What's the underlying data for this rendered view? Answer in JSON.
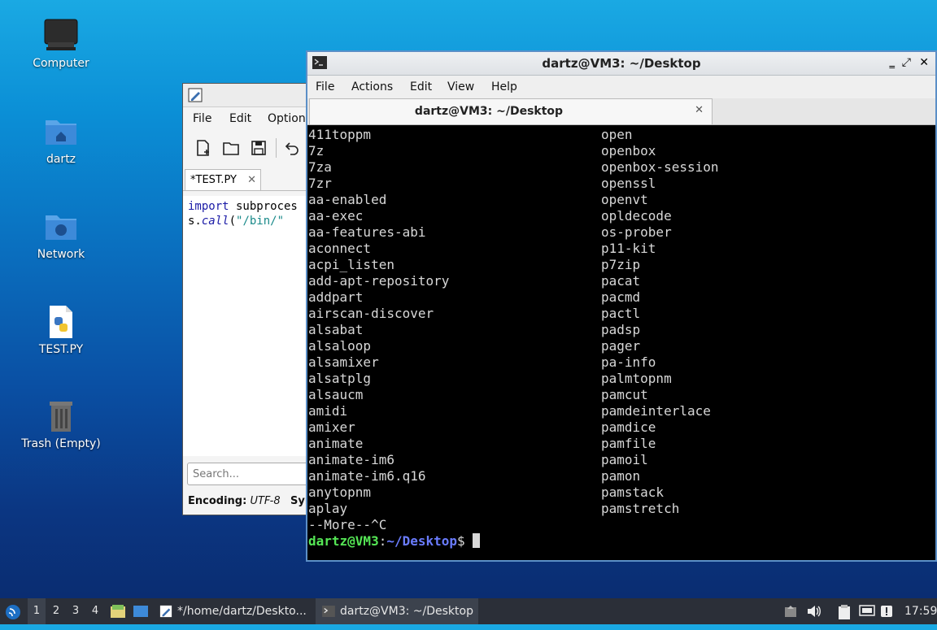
{
  "desktop": {
    "icons": [
      {
        "label": "Computer",
        "icon": "computer-icon"
      },
      {
        "label": "dartz",
        "icon": "home-folder-icon"
      },
      {
        "label": "Network",
        "icon": "network-folder-icon"
      },
      {
        "label": "TEST.PY",
        "icon": "python-file-icon"
      },
      {
        "label": "Trash (Empty)",
        "icon": "trash-icon"
      }
    ]
  },
  "editor": {
    "menu": [
      "File",
      "Edit",
      "Option"
    ],
    "tab_label": "*TEST.PY",
    "code_line1_kw": "import",
    "code_line1_rest": " subproces",
    "code_line2_pre": "s.",
    "code_line2_fn": "call",
    "code_line2_paren": "(",
    "code_line2_str": "\"/bin/\"",
    "search_placeholder": "Search...",
    "status_label": "Encoding:",
    "status_value": "UTF-8",
    "status_trail": "Syn"
  },
  "terminal": {
    "title": "dartz@VM3: ~/Desktop",
    "menu": [
      "File",
      "Actions",
      "Edit",
      "View",
      "Help"
    ],
    "tab_title": "dartz@VM3: ~/Desktop",
    "col1": [
      "411toppm",
      "7z",
      "7za",
      "7zr",
      "aa-enabled",
      "aa-exec",
      "aa-features-abi",
      "aconnect",
      "acpi_listen",
      "add-apt-repository",
      "addpart",
      "airscan-discover",
      "alsabat",
      "alsaloop",
      "alsamixer",
      "alsatplg",
      "alsaucm",
      "amidi",
      "amixer",
      "animate",
      "animate-im6",
      "animate-im6.q16",
      "anytopnm",
      "aplay",
      "--More--^C"
    ],
    "col2": [
      "open",
      "openbox",
      "openbox-session",
      "openssl",
      "openvt",
      "opldecode",
      "os-prober",
      "p11-kit",
      "p7zip",
      "pacat",
      "pacmd",
      "pactl",
      "padsp",
      "pager",
      "pa-info",
      "palmtopnm",
      "pamcut",
      "pamdeinterlace",
      "pamdice",
      "pamfile",
      "pamoil",
      "pamon",
      "pamstack",
      "pamstretch"
    ],
    "prompt_user": "dartz@VM3",
    "prompt_colon": ":",
    "prompt_path": "~/Desktop",
    "prompt_dollar": "$"
  },
  "taskbar": {
    "workspaces": [
      "1",
      "2",
      "3",
      "4"
    ],
    "tasks": [
      {
        "label": "*/home/dartz/Deskto..."
      },
      {
        "label": "dartz@VM3: ~/Desktop"
      }
    ],
    "clock": "17:59"
  },
  "colors": {
    "prompt_user": "#55e655",
    "prompt_path": "#6a7cff",
    "python_keyword": "#1a1aa6",
    "python_string": "#1a8a8a",
    "terminal_border": "#5b8fc7"
  }
}
